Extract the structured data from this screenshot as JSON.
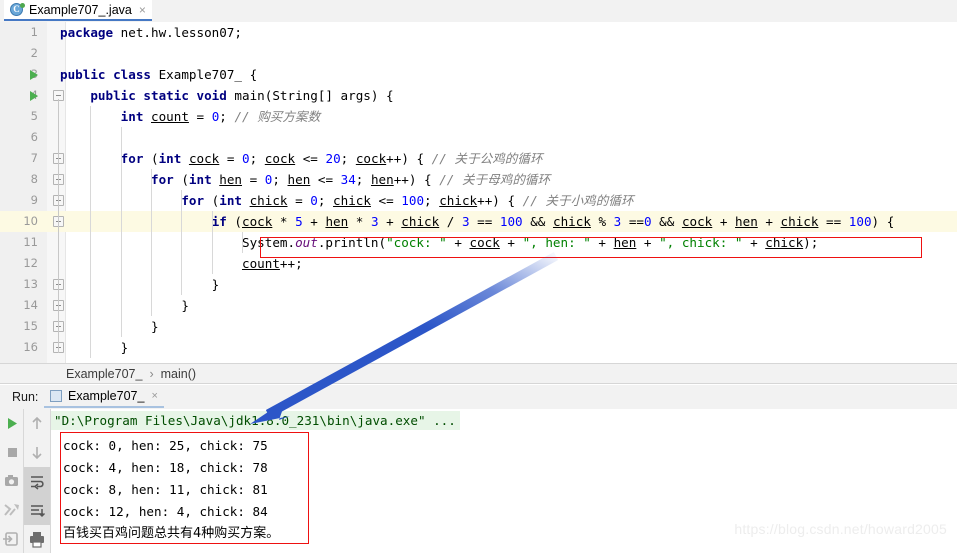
{
  "editor_tab": {
    "label": "Example707_.java",
    "icon": "java-class-icon",
    "icon_letter": "C",
    "close": "×"
  },
  "editor": {
    "lines": [
      {
        "n": "1",
        "indent_guides": 0,
        "fold": false,
        "run": false,
        "tokens": [
          {
            "t": "package",
            "c": "kw"
          },
          {
            "t": " net.hw.lesson07;",
            "c": "pl"
          }
        ]
      },
      {
        "n": "2",
        "indent_guides": 0,
        "fold": false,
        "run": false,
        "tokens": []
      },
      {
        "n": "3",
        "indent_guides": 0,
        "fold": false,
        "run": true,
        "tokens": [
          {
            "t": "public class",
            "c": "kw"
          },
          {
            "t": " Example707_ {",
            "c": "pl"
          }
        ]
      },
      {
        "n": "4",
        "indent_guides": 1,
        "fold": true,
        "run": true,
        "tokens": [
          {
            "t": "    ",
            "c": "pl"
          },
          {
            "t": "public static void",
            "c": "kw"
          },
          {
            "t": " main(String[] args) {",
            "c": "pl"
          }
        ]
      },
      {
        "n": "5",
        "indent_guides": 2,
        "fold": false,
        "run": false,
        "tokens": [
          {
            "t": "        ",
            "c": "pl"
          },
          {
            "t": "int",
            "c": "kw"
          },
          {
            "t": " ",
            "c": "pl"
          },
          {
            "t": "count",
            "c": "var"
          },
          {
            "t": " = ",
            "c": "pl"
          },
          {
            "t": "0",
            "c": "num"
          },
          {
            "t": "; ",
            "c": "pl"
          },
          {
            "t": "// 购买方案数",
            "c": "cmt"
          }
        ]
      },
      {
        "n": "6",
        "indent_guides": 2,
        "fold": false,
        "run": false,
        "tokens": []
      },
      {
        "n": "7",
        "indent_guides": 2,
        "fold": true,
        "run": false,
        "tokens": [
          {
            "t": "        ",
            "c": "pl"
          },
          {
            "t": "for",
            "c": "kw"
          },
          {
            "t": " (",
            "c": "pl"
          },
          {
            "t": "int",
            "c": "kw"
          },
          {
            "t": " ",
            "c": "pl"
          },
          {
            "t": "cock",
            "c": "var"
          },
          {
            "t": " = ",
            "c": "pl"
          },
          {
            "t": "0",
            "c": "num"
          },
          {
            "t": "; ",
            "c": "pl"
          },
          {
            "t": "cock",
            "c": "var"
          },
          {
            "t": " <= ",
            "c": "pl"
          },
          {
            "t": "20",
            "c": "num"
          },
          {
            "t": "; ",
            "c": "pl"
          },
          {
            "t": "cock",
            "c": "var"
          },
          {
            "t": "++) { ",
            "c": "pl"
          },
          {
            "t": "// 关于公鸡的循环",
            "c": "cmt"
          }
        ]
      },
      {
        "n": "8",
        "indent_guides": 3,
        "fold": true,
        "run": false,
        "tokens": [
          {
            "t": "            ",
            "c": "pl"
          },
          {
            "t": "for",
            "c": "kw"
          },
          {
            "t": " (",
            "c": "pl"
          },
          {
            "t": "int",
            "c": "kw"
          },
          {
            "t": " ",
            "c": "pl"
          },
          {
            "t": "hen",
            "c": "var"
          },
          {
            "t": " = ",
            "c": "pl"
          },
          {
            "t": "0",
            "c": "num"
          },
          {
            "t": "; ",
            "c": "pl"
          },
          {
            "t": "hen",
            "c": "var"
          },
          {
            "t": " <= ",
            "c": "pl"
          },
          {
            "t": "34",
            "c": "num"
          },
          {
            "t": "; ",
            "c": "pl"
          },
          {
            "t": "hen",
            "c": "var"
          },
          {
            "t": "++) { ",
            "c": "pl"
          },
          {
            "t": "// 关于母鸡的循环",
            "c": "cmt"
          }
        ]
      },
      {
        "n": "9",
        "indent_guides": 4,
        "fold": true,
        "run": false,
        "tokens": [
          {
            "t": "                ",
            "c": "pl"
          },
          {
            "t": "for",
            "c": "kw"
          },
          {
            "t": " (",
            "c": "pl"
          },
          {
            "t": "int",
            "c": "kw"
          },
          {
            "t": " ",
            "c": "pl"
          },
          {
            "t": "chick",
            "c": "var"
          },
          {
            "t": " = ",
            "c": "pl"
          },
          {
            "t": "0",
            "c": "num"
          },
          {
            "t": "; ",
            "c": "pl"
          },
          {
            "t": "chick",
            "c": "var"
          },
          {
            "t": " <= ",
            "c": "pl"
          },
          {
            "t": "100",
            "c": "num"
          },
          {
            "t": "; ",
            "c": "pl"
          },
          {
            "t": "chick",
            "c": "var"
          },
          {
            "t": "++) { ",
            "c": "pl"
          },
          {
            "t": "// 关于小鸡的循环",
            "c": "cmt"
          }
        ]
      },
      {
        "n": "10",
        "indent_guides": 5,
        "fold": true,
        "run": false,
        "highlight": true,
        "tokens": [
          {
            "t": "                    ",
            "c": "pl"
          },
          {
            "t": "if",
            "c": "kw"
          },
          {
            "t": " (",
            "c": "pl"
          },
          {
            "t": "cock",
            "c": "var"
          },
          {
            "t": " * ",
            "c": "pl"
          },
          {
            "t": "5",
            "c": "num"
          },
          {
            "t": " + ",
            "c": "pl"
          },
          {
            "t": "hen",
            "c": "var"
          },
          {
            "t": " * ",
            "c": "pl"
          },
          {
            "t": "3",
            "c": "num"
          },
          {
            "t": " + ",
            "c": "pl"
          },
          {
            "t": "chick",
            "c": "var"
          },
          {
            "t": " / ",
            "c": "pl"
          },
          {
            "t": "3",
            "c": "num"
          },
          {
            "t": " == ",
            "c": "pl"
          },
          {
            "t": "100",
            "c": "num"
          },
          {
            "t": " && ",
            "c": "pl"
          },
          {
            "t": "chick",
            "c": "var"
          },
          {
            "t": " % ",
            "c": "pl"
          },
          {
            "t": "3",
            "c": "num"
          },
          {
            "t": " ==",
            "c": "pl"
          },
          {
            "t": "0",
            "c": "num"
          },
          {
            "t": " && ",
            "c": "pl"
          },
          {
            "t": "cock",
            "c": "var"
          },
          {
            "t": " + ",
            "c": "pl"
          },
          {
            "t": "hen",
            "c": "var"
          },
          {
            "t": " + ",
            "c": "pl"
          },
          {
            "t": "chick",
            "c": "var"
          },
          {
            "t": " == ",
            "c": "pl"
          },
          {
            "t": "100",
            "c": "num"
          },
          {
            "t": ") {",
            "c": "pl"
          }
        ]
      },
      {
        "n": "11",
        "indent_guides": 6,
        "fold": false,
        "run": false,
        "tokens": [
          {
            "t": "                        ",
            "c": "pl"
          },
          {
            "t": "System.",
            "c": "pl"
          },
          {
            "t": "out",
            "c": "fld"
          },
          {
            "t": ".println(",
            "c": "pl"
          },
          {
            "t": "\"cock: \"",
            "c": "str"
          },
          {
            "t": " + ",
            "c": "pl"
          },
          {
            "t": "cock",
            "c": "var"
          },
          {
            "t": " + ",
            "c": "pl"
          },
          {
            "t": "\", hen: \"",
            "c": "str"
          },
          {
            "t": " + ",
            "c": "pl"
          },
          {
            "t": "hen",
            "c": "var"
          },
          {
            "t": " + ",
            "c": "pl"
          },
          {
            "t": "\", chick: \"",
            "c": "str"
          },
          {
            "t": " + ",
            "c": "pl"
          },
          {
            "t": "chick",
            "c": "var"
          },
          {
            "t": ");",
            "c": "pl"
          }
        ]
      },
      {
        "n": "12",
        "indent_guides": 6,
        "fold": false,
        "run": false,
        "tokens": [
          {
            "t": "                        ",
            "c": "pl"
          },
          {
            "t": "count",
            "c": "var"
          },
          {
            "t": "++;",
            "c": "pl"
          }
        ]
      },
      {
        "n": "13",
        "indent_guides": 5,
        "fold": true,
        "run": false,
        "tokens": [
          {
            "t": "                    }",
            "c": "pl"
          }
        ]
      },
      {
        "n": "14",
        "indent_guides": 4,
        "fold": true,
        "run": false,
        "tokens": [
          {
            "t": "                }",
            "c": "pl"
          }
        ]
      },
      {
        "n": "15",
        "indent_guides": 3,
        "fold": true,
        "run": false,
        "tokens": [
          {
            "t": "            }",
            "c": "pl"
          }
        ]
      },
      {
        "n": "16",
        "indent_guides": 2,
        "fold": true,
        "run": false,
        "tokens": [
          {
            "t": "        }",
            "c": "pl"
          }
        ]
      }
    ]
  },
  "breadcrumb": {
    "class": "Example707_",
    "separator": "›",
    "method": "main()"
  },
  "run_panel": {
    "label": "Run:",
    "tab_label": "Example707_",
    "tab_close": "×",
    "toolbar_left": [
      {
        "name": "rerun-icon",
        "glyph": "▶"
      },
      {
        "name": "stop-icon",
        "glyph": "■"
      },
      {
        "name": "camera-icon",
        "glyph": "camera"
      },
      {
        "name": "thread-dump-icon",
        "glyph": "threads"
      },
      {
        "name": "console-input-icon",
        "glyph": "login"
      }
    ],
    "toolbar_right": [
      {
        "name": "scroll-up-icon",
        "glyph": "↑",
        "active": false
      },
      {
        "name": "scroll-down-icon",
        "glyph": "↓",
        "active": false
      },
      {
        "name": "soft-wrap-icon",
        "glyph": "wrap",
        "active": true
      },
      {
        "name": "scroll-to-end-icon",
        "glyph": "toend",
        "active": true
      },
      {
        "name": "print-icon",
        "glyph": "printer",
        "active": false
      }
    ],
    "console": {
      "command": "\"D:\\Program Files\\Java\\jdk1.8.0_231\\bin\\java.exe\" ...",
      "output": [
        "cock: 0, hen: 25, chick: 75",
        "cock: 4, hen: 18, chick: 78",
        "cock: 8, hen: 11, chick: 81",
        "cock: 12, hen: 4, chick: 84"
      ],
      "summary": "百钱买百鸡问题总共有4种购买方案。"
    }
  },
  "annotations": {
    "condition_box_color": "#ee1111",
    "output_box_color": "#ee1111",
    "arrow_color": "#2c56c8"
  },
  "watermark": {
    "text": "https://blog.csdn.net/howard2005"
  }
}
